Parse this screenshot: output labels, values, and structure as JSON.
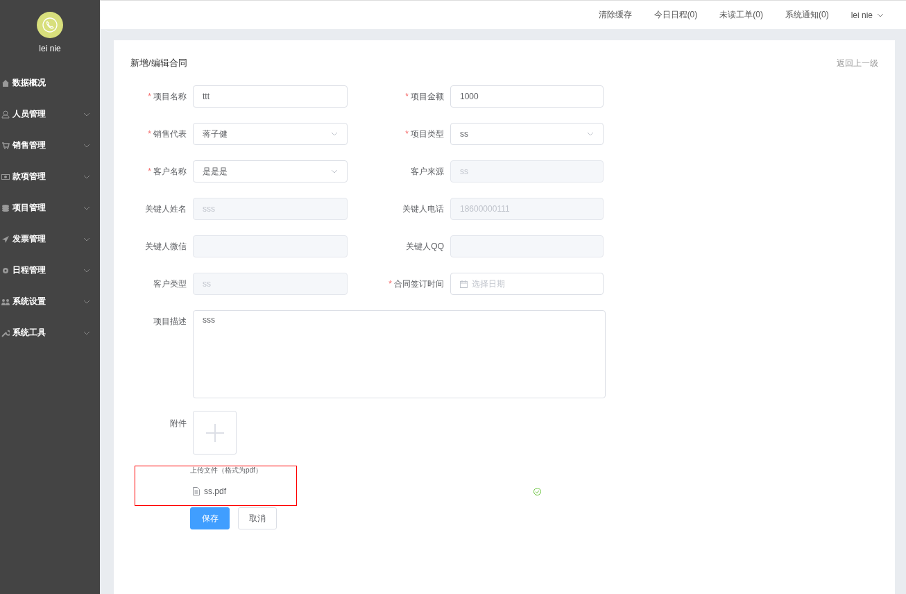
{
  "sidebar": {
    "user_name": "lei nie",
    "items": [
      {
        "label": "数据概况",
        "expandable": false
      },
      {
        "label": "人员管理",
        "expandable": true
      },
      {
        "label": "销售管理",
        "expandable": true
      },
      {
        "label": "款项管理",
        "expandable": true
      },
      {
        "label": "项目管理",
        "expandable": true
      },
      {
        "label": "发票管理",
        "expandable": true
      },
      {
        "label": "日程管理",
        "expandable": true
      },
      {
        "label": "系统设置",
        "expandable": true
      },
      {
        "label": "系统工具",
        "expandable": true
      }
    ]
  },
  "header": {
    "links": [
      "清除缓存",
      "今日日程(0)",
      "未读工单(0)",
      "系统通知(0)"
    ],
    "user": "lei nie"
  },
  "form": {
    "title": "新增/编辑合同",
    "back_link": "返回上一级",
    "fields": [
      {
        "label": "项目名称",
        "mark": "*",
        "kind": "input",
        "value": "ttt"
      },
      {
        "label": "项目金额",
        "mark": "*",
        "kind": "input",
        "value": "1000"
      },
      {
        "label": "销售代表",
        "mark": "*",
        "kind": "select",
        "value": "蒋子健"
      },
      {
        "label": "项目类型",
        "mark": "*",
        "kind": "select",
        "value": "ss"
      },
      {
        "label": "客户名称",
        "mark": "*",
        "kind": "select",
        "value": "是是是"
      },
      {
        "label": "客户来源",
        "kind": "disabled",
        "value": "ss"
      },
      {
        "label": "关键人姓名",
        "kind": "disabled",
        "value": "sss"
      },
      {
        "label": "关键人电话",
        "kind": "disabled",
        "value": "18600000111"
      },
      {
        "label": "关键人微信",
        "kind": "disabled"
      },
      {
        "label": "关键人QQ",
        "kind": "disabled"
      },
      {
        "label": "客户类型",
        "kind": "disabled",
        "value": "ss"
      },
      {
        "label": "合同签订时间",
        "mark": "*",
        "kind": "date",
        "placeholder": "选择日期"
      }
    ],
    "description": {
      "label": "项目描述",
      "value": "sss"
    },
    "attachment": {
      "label": "附件",
      "hint": "上传文件（格式为pdf）",
      "highlighted": true,
      "files": [
        {
          "name": "ss.pdf",
          "uploaded": true
        }
      ]
    },
    "buttons": [
      {
        "label": "保存",
        "kind": "primary"
      },
      {
        "label": "取消",
        "kind": "default"
      }
    ]
  }
}
